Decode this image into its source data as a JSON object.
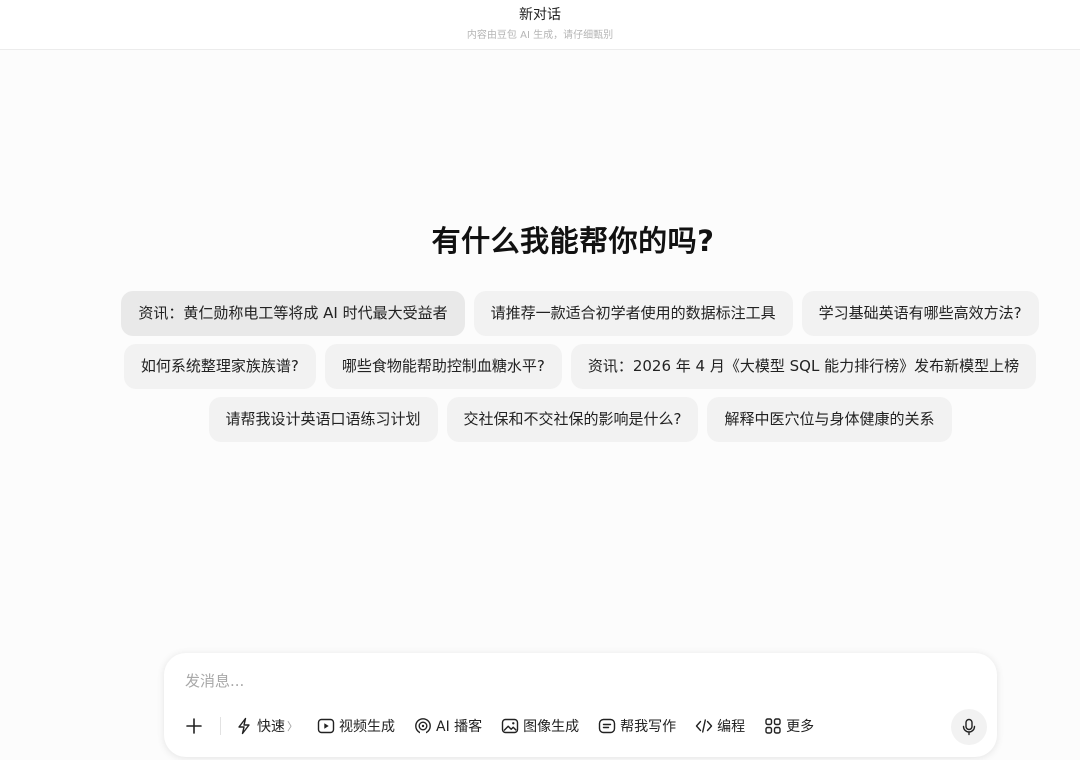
{
  "header": {
    "title": "新对话",
    "subtitle": "内容由豆包 AI 生成，请仔细甄别"
  },
  "main": {
    "headline": "有什么我能帮你的吗?",
    "suggestions": [
      [
        "资讯：黄仁勋称电工等将成 AI 时代最大受益者",
        "请推荐一款适合初学者使用的数据标注工具",
        "学习基础英语有哪些高效方法?"
      ],
      [
        "如何系统整理家族族谱?",
        "哪些食物能帮助控制血糖水平?",
        "资讯：2026 年 4 月《大模型 SQL 能力排行榜》发布新模型上榜"
      ],
      [
        "请帮我设计英语口语练习计划",
        "交社保和不交社保的影响是什么?",
        "解释中医穴位与身体健康的关系"
      ]
    ]
  },
  "composer": {
    "placeholder": "发消息...",
    "value": "",
    "tools": [
      {
        "icon": "lightning-icon",
        "label": "快速",
        "suffix": "〉"
      },
      {
        "icon": "video-play-icon",
        "label": "视频生成"
      },
      {
        "icon": "podcast-icon",
        "label": "AI 播客"
      },
      {
        "icon": "image-icon",
        "label": "图像生成"
      },
      {
        "icon": "writing-icon",
        "label": "帮我写作"
      },
      {
        "icon": "code-icon",
        "label": "编程"
      },
      {
        "icon": "grid-icon",
        "label": "更多"
      }
    ],
    "plus_icon": "plus-icon",
    "mic_icon": "microphone-icon"
  },
  "colors": {
    "background": "#fcfcfc",
    "chip": "#f2f2f2",
    "chip_hover": "#e9e9e9",
    "text": "#222222",
    "muted": "#b5b5b5"
  }
}
